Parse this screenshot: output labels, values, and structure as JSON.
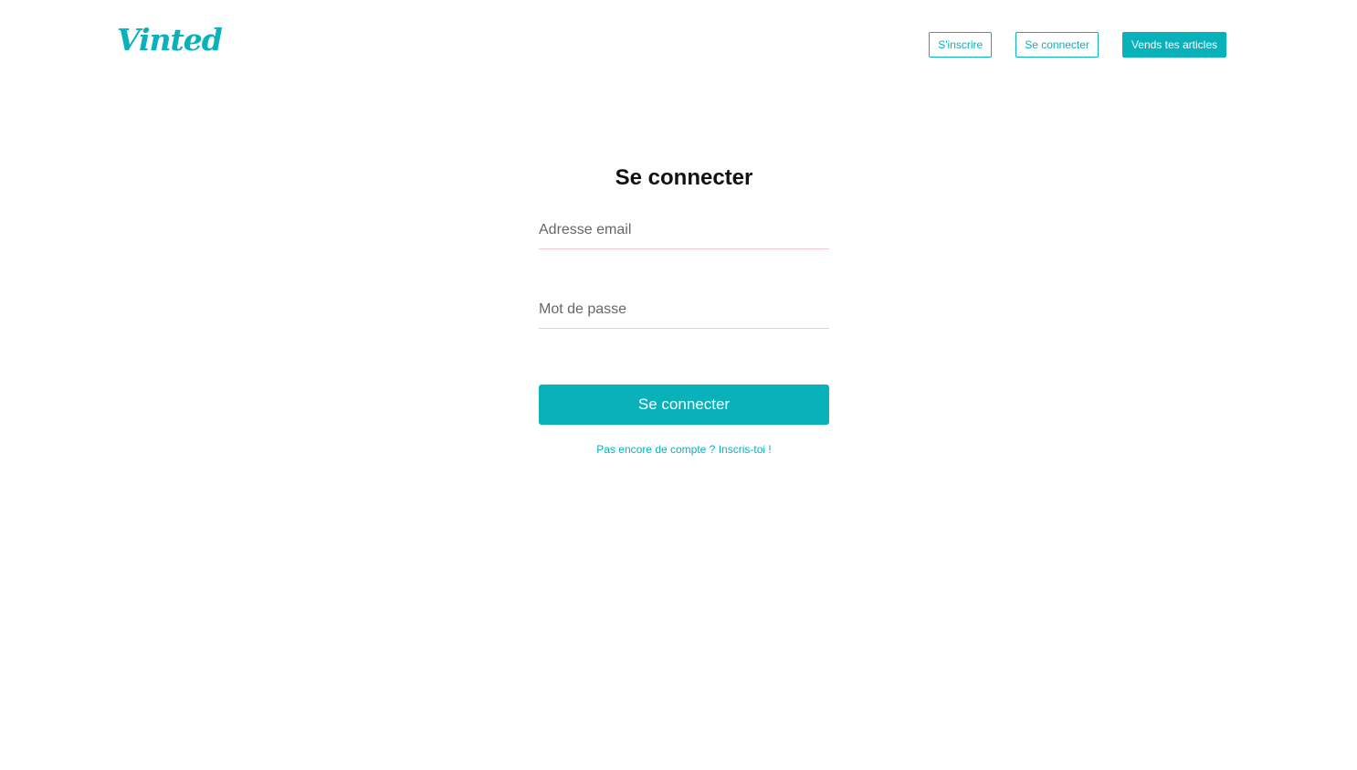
{
  "header": {
    "logo": "Vinted",
    "signup_label": "S'inscrire",
    "login_label": "Se connecter",
    "sell_label": "Vends tes articles"
  },
  "form": {
    "title": "Se connecter",
    "email_placeholder": "Adresse email",
    "email_value": "",
    "password_placeholder": "Mot de passe",
    "password_value": "",
    "submit_label": "Se connecter",
    "signup_prompt": "Pas encore de compte ? Inscris-toi !"
  },
  "colors": {
    "brand": "#09b1ba",
    "input_underline": "#f4c8cb",
    "title_text": "#111111"
  }
}
